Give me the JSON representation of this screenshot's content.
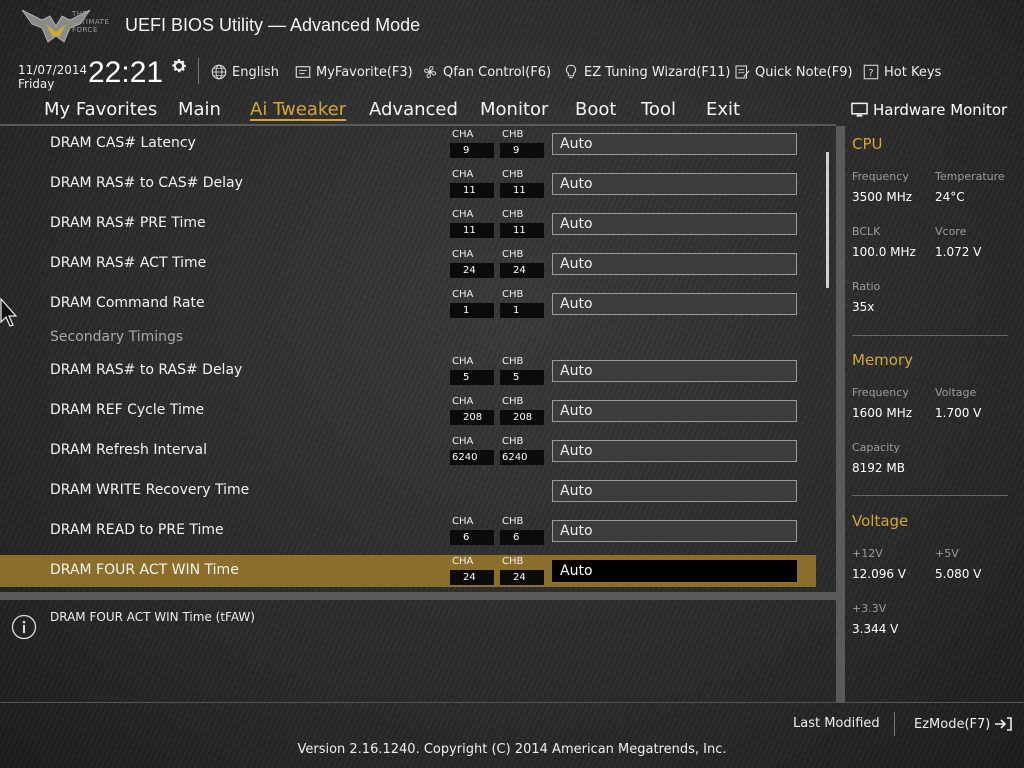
{
  "header": {
    "logo_text": [
      "THE",
      "ULTIMATE",
      "FORCE"
    ],
    "title": "UEFI BIOS Utility — Advanced Mode",
    "date": "11/07/2014",
    "day": "Friday",
    "time": "22:21",
    "language": "English",
    "my_favorite": "MyFavorite(F3)",
    "qfan": "Qfan Control(F6)",
    "ez_tuning": "EZ Tuning Wizard(F11)",
    "quick_note": "Quick Note(F9)",
    "hot_keys": "Hot Keys"
  },
  "nav": {
    "tabs": [
      "My Favorites",
      "Main",
      "Ai Tweaker",
      "Advanced",
      "Monitor",
      "Boot",
      "Tool",
      "Exit"
    ],
    "active": "Ai Tweaker"
  },
  "settings": {
    "channel_a": "CHA",
    "channel_b": "CHB",
    "secondary_heading": "Secondary Timings",
    "rows": [
      {
        "label": "DRAM CAS# Latency",
        "cha": "9",
        "chb": "9",
        "value": "Auto"
      },
      {
        "label": "DRAM RAS# to CAS# Delay",
        "cha": "11",
        "chb": "11",
        "value": "Auto"
      },
      {
        "label": "DRAM RAS# PRE Time",
        "cha": "11",
        "chb": "11",
        "value": "Auto"
      },
      {
        "label": "DRAM RAS# ACT Time",
        "cha": "24",
        "chb": "24",
        "value": "Auto"
      },
      {
        "label": "DRAM Command Rate",
        "cha": "1",
        "chb": "1",
        "value": "Auto"
      },
      {
        "label": "DRAM RAS# to RAS# Delay",
        "cha": "5",
        "chb": "5",
        "value": "Auto"
      },
      {
        "label": "DRAM REF Cycle Time",
        "cha": "208",
        "chb": "208",
        "value": "Auto"
      },
      {
        "label": "DRAM Refresh Interval",
        "cha": "6240",
        "chb": "6240",
        "value": "Auto"
      },
      {
        "label": "DRAM WRITE Recovery Time",
        "cha": "",
        "chb": "",
        "value": "Auto"
      },
      {
        "label": "DRAM READ to PRE Time",
        "cha": "6",
        "chb": "6",
        "value": "Auto"
      },
      {
        "label": "DRAM FOUR ACT WIN Time",
        "cha": "24",
        "chb": "24",
        "value": "Auto"
      }
    ]
  },
  "help": {
    "text": "DRAM FOUR ACT WIN Time (tFAW)"
  },
  "hardware_monitor": {
    "title": "Hardware Monitor",
    "cpu": {
      "heading": "CPU",
      "frequency_label": "Frequency",
      "frequency": "3500 MHz",
      "temperature_label": "Temperature",
      "temperature": "24°C",
      "bclk_label": "BCLK",
      "bclk": "100.0 MHz",
      "vcore_label": "Vcore",
      "vcore": "1.072 V",
      "ratio_label": "Ratio",
      "ratio": "35x"
    },
    "memory": {
      "heading": "Memory",
      "frequency_label": "Frequency",
      "frequency": "1600 MHz",
      "voltage_label": "Voltage",
      "voltage": "1.700 V",
      "capacity_label": "Capacity",
      "capacity": "8192 MB"
    },
    "voltage": {
      "heading": "Voltage",
      "v12_label": "+12V",
      "v12": "12.096 V",
      "v5_label": "+5V",
      "v5": "5.080 V",
      "v33_label": "+3.3V",
      "v33": "3.344 V"
    }
  },
  "footer": {
    "last_modified": "Last Modified",
    "ez_mode": "EzMode(F7)",
    "version": "Version 2.16.1240. Copyright (C) 2014 American Megatrends, Inc."
  },
  "colors": {
    "accent": "#d4a636",
    "selected_row": "#8c6e2b",
    "background": "#2a2a2a"
  }
}
